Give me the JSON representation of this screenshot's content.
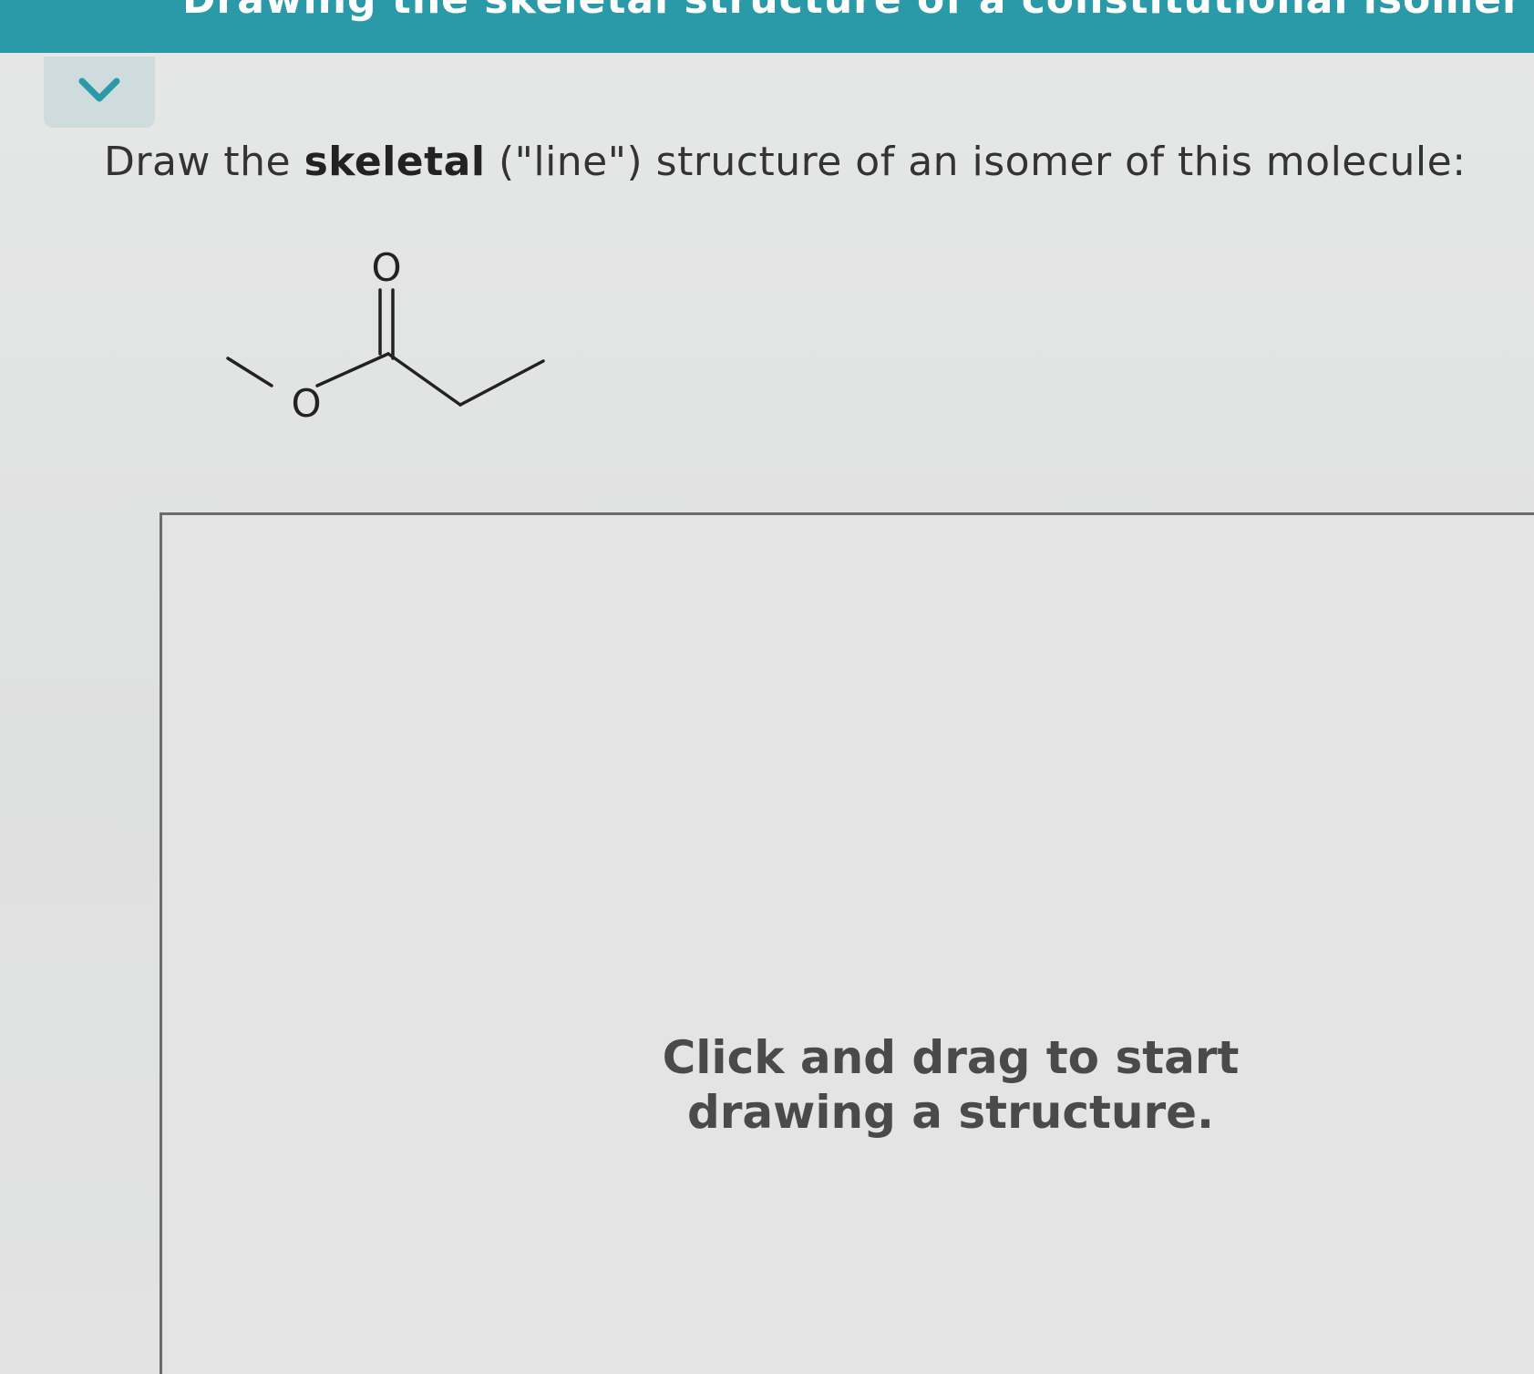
{
  "header": {
    "title": "Drawing the skeletal structure of a constitutional isomer"
  },
  "collapse_button": {
    "icon": "chevron-down-icon"
  },
  "question": {
    "prefix": "Draw the ",
    "bold": "skeletal",
    "suffix": " (\"line\") structure of an isomer of this molecule:"
  },
  "molecule": {
    "carbonyl_oxygen_label": "O",
    "ether_oxygen_label": "O"
  },
  "drawing_area": {
    "hint": "Click and drag to start drawing a structure."
  },
  "colors": {
    "header": "#2b9aa8",
    "collapse_button_bg": "#cfdcdd",
    "chevron": "#2b9aa8",
    "border": "#6b6b6b"
  }
}
